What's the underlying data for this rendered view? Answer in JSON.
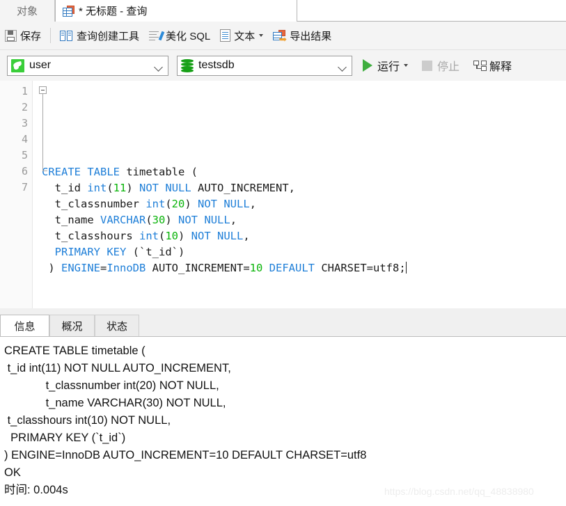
{
  "window": {
    "tabs": [
      {
        "label": "对象",
        "icon": "",
        "active": false
      },
      {
        "label": "* 无标题 - 查询",
        "icon": "table-grid-icon",
        "active": true
      }
    ]
  },
  "toolbar_main": {
    "items": [
      {
        "label": "保存",
        "icon": "save-icon"
      },
      {
        "label": "查询创建工具",
        "icon": "query-builder-icon"
      },
      {
        "label": "美化 SQL",
        "icon": "beautify-sql-icon"
      },
      {
        "label": "文本",
        "icon": "text-doc-icon",
        "has_dropdown": true
      },
      {
        "label": "导出结果",
        "icon": "export-result-icon"
      }
    ]
  },
  "toolbar_exec": {
    "connection": {
      "value": "user",
      "icon": "mysql-dolphin-icon"
    },
    "database": {
      "value": "testsdb",
      "icon": "database-cylinder-icon"
    },
    "run": {
      "label": "运行",
      "icon": "play-icon",
      "has_dropdown": true,
      "enabled": true
    },
    "stop": {
      "label": "停止",
      "icon": "stop-square-icon",
      "enabled": false
    },
    "explain": {
      "label": "解释",
      "icon": "explain-plan-icon",
      "enabled": true
    }
  },
  "editor": {
    "line_numbers": [
      "1",
      "2",
      "3",
      "4",
      "5",
      "6",
      "7"
    ],
    "lines": [
      [
        {
          "t": "CREATE",
          "c": "kw"
        },
        {
          "t": " "
        },
        {
          "t": "TABLE",
          "c": "kw"
        },
        {
          "t": " timetable ("
        }
      ],
      [
        {
          "t": "  t_id "
        },
        {
          "t": "int",
          "c": "kw"
        },
        {
          "t": "("
        },
        {
          "t": "11",
          "c": "num"
        },
        {
          "t": ") "
        },
        {
          "t": "NOT",
          "c": "kw"
        },
        {
          "t": " "
        },
        {
          "t": "NULL",
          "c": "kw"
        },
        {
          "t": " AUTO_INCREMENT,"
        }
      ],
      [
        {
          "t": "  t_classnumber "
        },
        {
          "t": "int",
          "c": "kw"
        },
        {
          "t": "("
        },
        {
          "t": "20",
          "c": "num"
        },
        {
          "t": ") "
        },
        {
          "t": "NOT",
          "c": "kw"
        },
        {
          "t": " "
        },
        {
          "t": "NULL",
          "c": "kw"
        },
        {
          "t": ","
        }
      ],
      [
        {
          "t": "  t_name "
        },
        {
          "t": "VARCHAR",
          "c": "kw"
        },
        {
          "t": "("
        },
        {
          "t": "30",
          "c": "num"
        },
        {
          "t": ") "
        },
        {
          "t": "NOT",
          "c": "kw"
        },
        {
          "t": " "
        },
        {
          "t": "NULL",
          "c": "kw"
        },
        {
          "t": ","
        }
      ],
      [
        {
          "t": "  t_classhours "
        },
        {
          "t": "int",
          "c": "kw"
        },
        {
          "t": "("
        },
        {
          "t": "10",
          "c": "num"
        },
        {
          "t": ") "
        },
        {
          "t": "NOT",
          "c": "kw"
        },
        {
          "t": " "
        },
        {
          "t": "NULL",
          "c": "kw"
        },
        {
          "t": ","
        }
      ],
      [
        {
          "t": "  "
        },
        {
          "t": "PRIMARY",
          "c": "kw"
        },
        {
          "t": " "
        },
        {
          "t": "KEY",
          "c": "kw"
        },
        {
          "t": " (`t_id`)"
        }
      ],
      [
        {
          "t": " ) "
        },
        {
          "t": "ENGINE",
          "c": "kw"
        },
        {
          "t": "="
        },
        {
          "t": "InnoDB",
          "c": "kw"
        },
        {
          "t": " AUTO_INCREMENT="
        },
        {
          "t": "10",
          "c": "num"
        },
        {
          "t": " "
        },
        {
          "t": "DEFAULT",
          "c": "kw"
        },
        {
          "t": " CHARSET=utf8;"
        }
      ]
    ]
  },
  "result_tabs": [
    {
      "label": "信息",
      "active": true
    },
    {
      "label": "概况",
      "active": false
    },
    {
      "label": "状态",
      "active": false
    }
  ],
  "output": {
    "lines": [
      "CREATE TABLE timetable (",
      " t_id int(11) NOT NULL AUTO_INCREMENT,",
      "             t_classnumber int(20) NOT NULL,",
      "             t_name VARCHAR(30) NOT NULL,",
      " t_classhours int(10) NOT NULL,",
      "  PRIMARY KEY (`t_id`)",
      ") ENGINE=InnoDB AUTO_INCREMENT=10 DEFAULT CHARSET=utf8",
      "OK",
      "时间: 0.004s"
    ]
  },
  "watermark": "https://blog.csdn.net/qq_48838980",
  "colors": {
    "keyword": "#1f7fd8",
    "number": "#0ab40a",
    "run_green": "#3fae3f",
    "chrome": "#f4f4f4"
  }
}
